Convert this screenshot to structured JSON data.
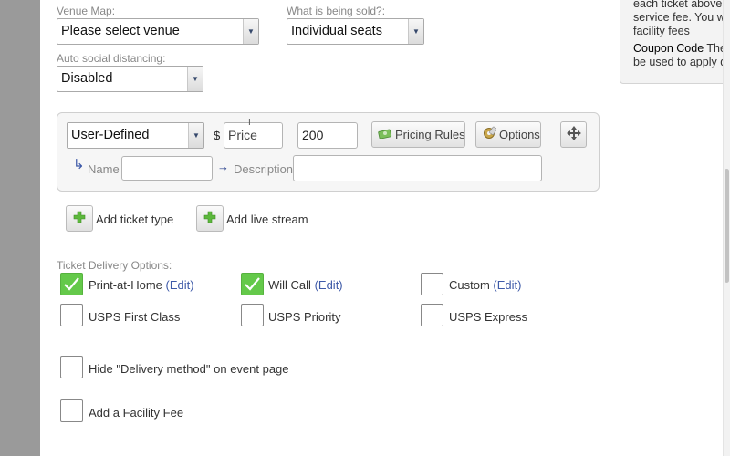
{
  "venue_map": {
    "label": "Venue Map:",
    "value": "Please select venue"
  },
  "what_sold": {
    "label": "What is being sold?:",
    "value": "Individual seats"
  },
  "social_distancing": {
    "label": "Auto social distancing:",
    "value": "Disabled"
  },
  "tooltip": {
    "lines": [
      "each ticket above",
      "service fee. You w",
      "facility fees"
    ],
    "coupon_title": "Coupon Code",
    "coupon_rest": " The",
    "coupon_line2": "be used to apply d"
  },
  "ticket": {
    "type_value": "User-Defined",
    "currency": "$",
    "price_placeholder": "Price",
    "quantity_value": "200",
    "pricing_rules_label": "Pricing Rules",
    "options_label": "Options",
    "name_label": "Name",
    "description_label": "Description",
    "name_value": "",
    "description_value": ""
  },
  "actions": {
    "add_ticket_type": "Add ticket type",
    "add_live_stream": "Add live stream"
  },
  "delivery": {
    "section_label": "Ticket Delivery Options:",
    "print_at_home": {
      "label": "Print-at-Home",
      "edit": "(Edit)",
      "checked": true
    },
    "will_call": {
      "label": "Will Call",
      "edit": "(Edit)",
      "checked": true
    },
    "custom": {
      "label": "Custom",
      "edit": "(Edit)",
      "checked": false
    },
    "usps_first_class": {
      "label": "USPS First Class",
      "checked": false
    },
    "usps_priority": {
      "label": "USPS Priority",
      "checked": false
    },
    "usps_express": {
      "label": "USPS Express",
      "checked": false
    }
  },
  "hide_delivery": {
    "label": "Hide \"Delivery method\" on event page",
    "checked": false
  },
  "facility_fee": {
    "label": "Add a Facility Fee",
    "checked": false
  },
  "colors": {
    "check_green": "#64c94a",
    "edit_link": "#3e5aa8",
    "gutter": "#9a9a9a"
  }
}
